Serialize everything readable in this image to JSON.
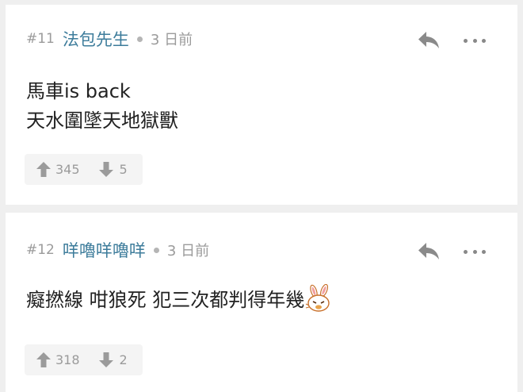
{
  "posts": [
    {
      "number": "#11",
      "username": "法包先生",
      "time": "3 日前",
      "content_lines": [
        "馬車is back",
        "天水圍墜天地獄獸"
      ],
      "upvotes": "345",
      "downvotes": "5"
    },
    {
      "number": "#12",
      "username": "咩嚕咩嚕咩",
      "time": "3 日前",
      "content_lines": [
        "癡撚線 咁狼死 犯三次都判得年幾"
      ],
      "upvotes": "318",
      "downvotes": "2"
    }
  ],
  "colors": {
    "username": "#3d7c9b",
    "meta_gray": "#9b9b9b",
    "background": "#efefef",
    "vote_bg": "#f4f4f4"
  },
  "icons": {
    "reply": "reply-icon",
    "more": "more-icon",
    "upvote": "arrow-up-icon",
    "downvote": "arrow-down-icon",
    "emoji": "bunny-emoji-icon"
  }
}
